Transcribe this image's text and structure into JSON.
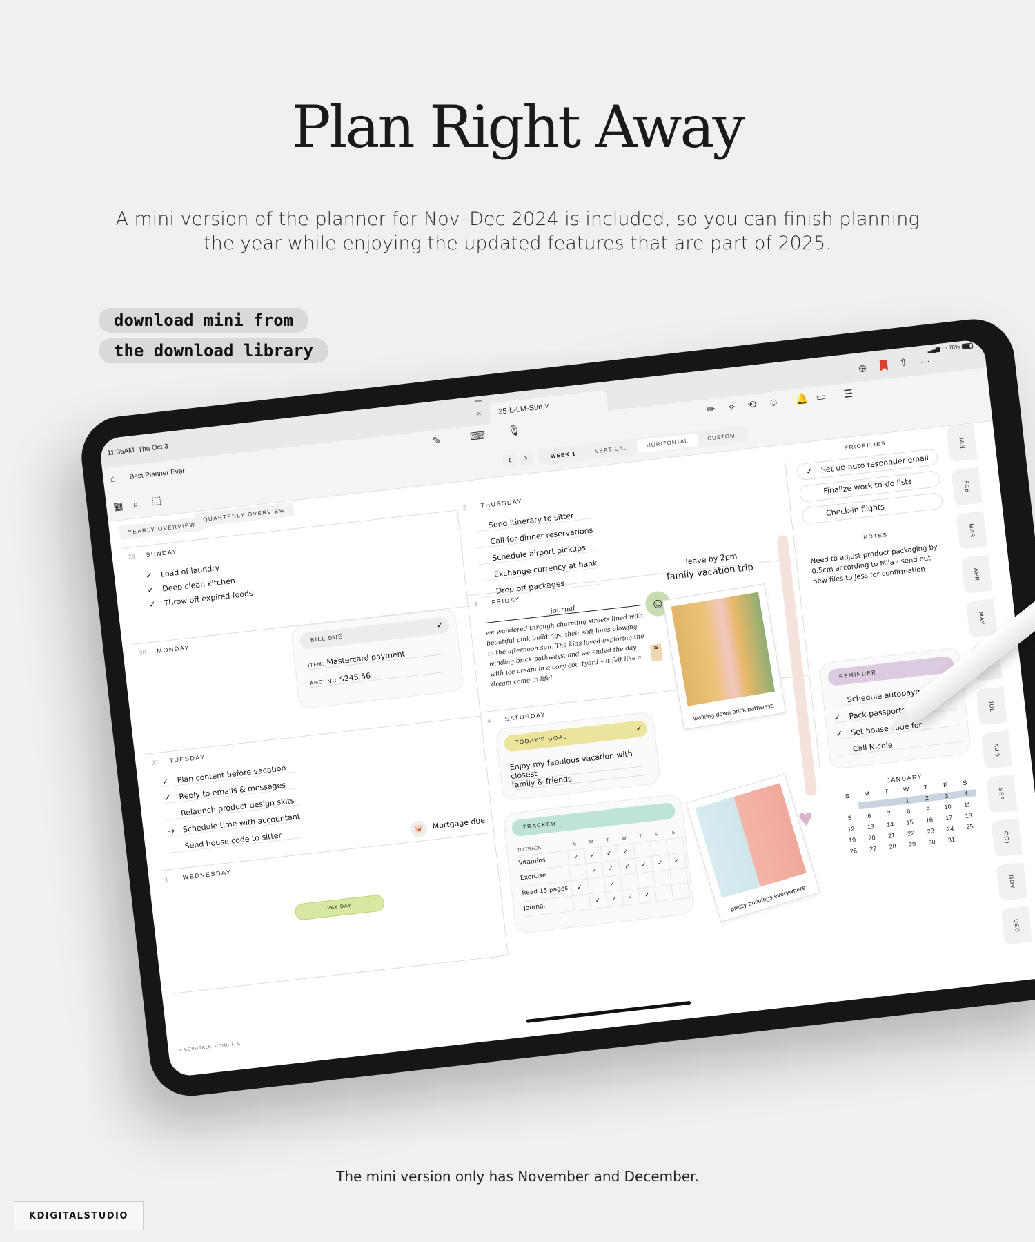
{
  "hero": {
    "title": "Plan Right Away",
    "subtitle_line1": "A mini version of the planner for Nov–Dec 2024 is included, so you can finish planning",
    "subtitle_line2": "the year while enjoying the updated features that are part of 2025.",
    "pill1": "download mini from",
    "pill2": "the download library",
    "caption": "The mini version only has November and December.",
    "brand": "KDIGITALSTUDIO"
  },
  "status": {
    "time": "11:35AM",
    "date": "Thu Oct 3",
    "battery": "76%"
  },
  "app": {
    "doc_tab": "25-L-LM-Sun",
    "notebook": "Best Planner Ever",
    "close": "×",
    "more": "•••",
    "ellipsis": "···"
  },
  "nav": {
    "prev": "‹",
    "next": "›",
    "segments": [
      "WEEK 1",
      "VERTICAL",
      "HORIZONTAL",
      "CUSTOM"
    ],
    "active_segment": "HORIZONTAL"
  },
  "overview_tabs": [
    "YEARLY OVERVIEW",
    "QUARTERLY OVERVIEW"
  ],
  "days": {
    "sunday": {
      "num": "29",
      "name": "SUNDAY",
      "items": [
        {
          "mark": "✓",
          "text": "Load of laundry"
        },
        {
          "mark": "✓",
          "text": "Deep clean kitchen"
        },
        {
          "mark": "✓",
          "text": "Throw off expired foods"
        }
      ]
    },
    "monday": {
      "num": "30",
      "name": "MONDAY",
      "bill": {
        "label": "BILL DUE",
        "item_label": "ITEM:",
        "item": "Mastercard payment",
        "amount_label": "AMOUNT:",
        "amount": "$245.56",
        "check": "✓"
      }
    },
    "tuesday": {
      "num": "31",
      "name": "TUESDAY",
      "items": [
        {
          "mark": "✓",
          "text": "Plan content before vacation"
        },
        {
          "mark": "✓",
          "text": "Reply to emails & messages"
        },
        {
          "mark": "",
          "text": "Relaunch product design skits"
        },
        {
          "mark": "→",
          "text": "Schedule time with accountant"
        },
        {
          "mark": "",
          "text": "Send house code to sitter"
        }
      ],
      "mortgage": "Mortgage due"
    },
    "wednesday": {
      "num": "1",
      "name": "WEDNESDAY",
      "payday": "PAY DAY"
    },
    "thursday": {
      "num": "2",
      "name": "THURSDAY",
      "items": [
        {
          "mark": "",
          "text": "Send itinerary to sitter"
        },
        {
          "mark": "",
          "text": "Call for dinner reservations"
        },
        {
          "mark": "",
          "text": "Schedule airport pickups"
        },
        {
          "mark": "",
          "text": "Exchange currency at bank"
        },
        {
          "mark": "",
          "text": "Drop off packages"
        }
      ]
    },
    "friday": {
      "num": "3",
      "name": "FRIDAY",
      "journal_label": "journal",
      "journal": "we wandered through charming streets lined with beautiful pink buildings, their soft hues glowing in the afternoon sun. The kids loved exploring the winding brick pathways, and we ended the day with ice cream in a cozy courtyard – it felt like a dream come to life!",
      "note1": "leave by 2pm",
      "note2": "family vacation trip",
      "photo1_caption": "walking down brick pathways"
    },
    "saturday": {
      "num": "4",
      "name": "SATURDAY",
      "goal_label": "TODAY'S GOAL",
      "goal_line1": "Enjoy my fabulous vacation with closest",
      "goal_line2": "family & friends",
      "photo2_caption": "pretty buildings everywhere"
    }
  },
  "tracker": {
    "label": "TRACKER",
    "to_track": "TO TRACK",
    "days": [
      "S",
      "M",
      "T",
      "W",
      "T",
      "F",
      "S"
    ],
    "rows": [
      {
        "name": "Vitamins",
        "checks": [
          1,
          1,
          1,
          1,
          0,
          0,
          0
        ]
      },
      {
        "name": "Exercise",
        "checks": [
          0,
          1,
          1,
          1,
          1,
          1,
          1
        ]
      },
      {
        "name": "Read 15 pages",
        "checks": [
          1,
          0,
          1,
          0,
          0,
          0,
          0
        ]
      },
      {
        "name": "Journal",
        "checks": [
          0,
          1,
          1,
          1,
          1,
          0,
          0
        ]
      }
    ]
  },
  "priorities": {
    "heading": "PRIORITIES",
    "items": [
      {
        "mark": "✓",
        "text": "Set up auto responder email"
      },
      {
        "mark": "",
        "text": "Finalize work to-do lists"
      },
      {
        "mark": "",
        "text": "Check-in flights"
      }
    ]
  },
  "notes": {
    "heading": "NOTES",
    "text": "Need to adjust product packaging by 0.5cm according to Mila - send out new files to Jess for confirmation"
  },
  "reminder": {
    "label": "REMINDER",
    "items": [
      {
        "mark": "",
        "text": "Schedule autopayments"
      },
      {
        "mark": "✓",
        "text": "Pack passports"
      },
      {
        "mark": "✓",
        "text": "Set house code for"
      },
      {
        "mark": "",
        "text": "Call Nicole"
      }
    ]
  },
  "calendar": {
    "month": "JANUARY",
    "weekdays": [
      "S",
      "M",
      "T",
      "W",
      "T",
      "F",
      "S"
    ],
    "first_weekday": 3,
    "days_in_month": 31,
    "highlight": [
      1,
      2,
      3,
      4
    ]
  },
  "months": [
    "JAN",
    "FEB",
    "MAR",
    "APR",
    "MAY",
    "JUN",
    "JUL",
    "AUG",
    "SEP",
    "OCT",
    "NOV",
    "DEC"
  ],
  "footer": "© KDIGITALSTUDIO, LLC",
  "colors": {
    "goal": "#ece39c",
    "tracker": "#bfe3d9",
    "reminder": "#dccbe0",
    "payday": "#d7e8a3",
    "calendar_highlight": "#c9d4e0",
    "bookmark": "#d9432f",
    "accent_bar": "#f6e2dc",
    "smiley": "#c8dcb4",
    "heart": "#dcb3cf"
  }
}
